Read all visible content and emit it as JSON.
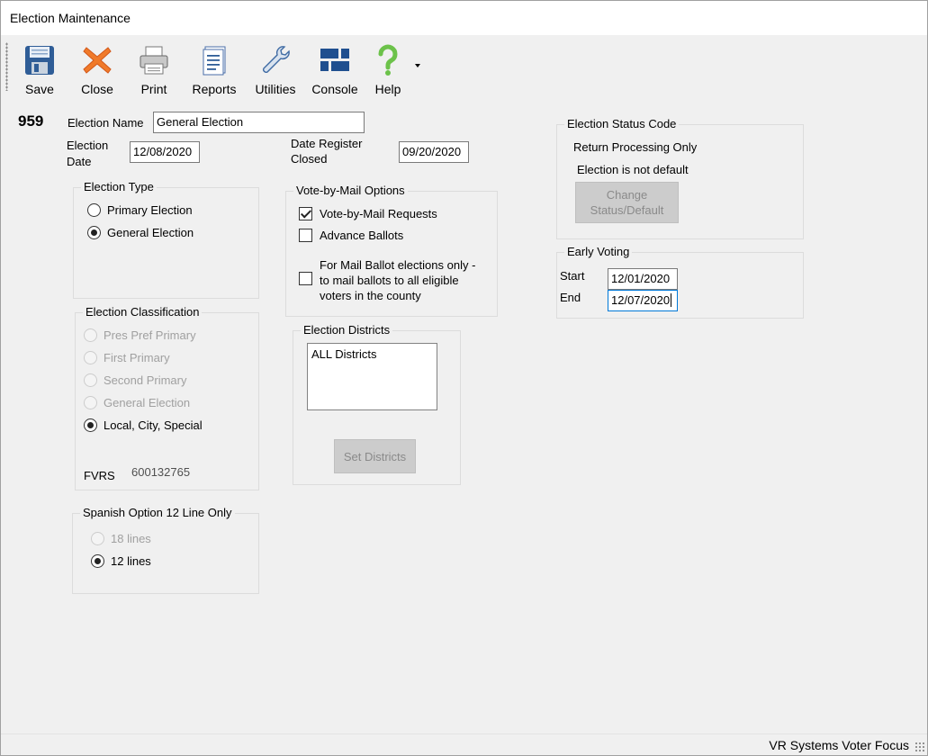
{
  "window": {
    "title": "Election Maintenance"
  },
  "toolbar": {
    "items": [
      {
        "label": "Save",
        "icon": "save-icon"
      },
      {
        "label": "Close",
        "icon": "close-icon"
      },
      {
        "label": "Print",
        "icon": "print-icon"
      },
      {
        "label": "Reports",
        "icon": "reports-icon"
      },
      {
        "label": "Utilities",
        "icon": "utilities-icon"
      },
      {
        "label": "Console",
        "icon": "console-icon"
      },
      {
        "label": "Help",
        "icon": "help-icon"
      }
    ]
  },
  "election": {
    "id": "959",
    "name_label": "Election Name",
    "name_value": "General Election",
    "date_label_1": "Election",
    "date_label_2": "Date",
    "date_value": "12/08/2020",
    "register_label_1": "Date Register",
    "register_label_2": "Closed",
    "register_value": "09/20/2020"
  },
  "election_type": {
    "title": "Election Type",
    "options": [
      {
        "label": "Primary Election",
        "selected": false
      },
      {
        "label": "General Election",
        "selected": true
      }
    ]
  },
  "classification": {
    "title": "Election Classification",
    "options": [
      {
        "label": "Pres Pref Primary",
        "selected": false,
        "enabled": false
      },
      {
        "label": "First Primary",
        "selected": false,
        "enabled": false
      },
      {
        "label": "Second Primary",
        "selected": false,
        "enabled": false
      },
      {
        "label": "General Election",
        "selected": false,
        "enabled": false
      },
      {
        "label": "Local, City, Special",
        "selected": true,
        "enabled": true
      }
    ],
    "fvrs_label": "FVRS",
    "fvrs_value": "600132765"
  },
  "spanish_option": {
    "title": "Spanish Option 12 Line Only",
    "options": [
      {
        "label": "18 lines",
        "selected": false,
        "enabled": false
      },
      {
        "label": "12 lines",
        "selected": true,
        "enabled": true
      }
    ]
  },
  "vbm": {
    "title": "Vote-by-Mail Options",
    "requests_label": "Vote-by-Mail Requests",
    "requests_checked": true,
    "advance_label": "Advance Ballots",
    "advance_checked": false,
    "mail_ballot_line1": "For Mail Ballot elections only -",
    "mail_ballot_line2": "to mail ballots to all eligible",
    "mail_ballot_line3": "voters in the county",
    "mail_ballot_checked": false
  },
  "districts": {
    "title": "Election Districts",
    "items": [
      "ALL Districts"
    ],
    "set_button": "Set Districts"
  },
  "status": {
    "title": "Election Status Code",
    "line1": "Return Processing Only",
    "line2": "Election is not default",
    "change_button_line1": "Change",
    "change_button_line2": "Status/Default"
  },
  "early_voting": {
    "title": "Early Voting",
    "start_label": "Start",
    "start_value": "12/01/2020",
    "end_label": "End",
    "end_value": "12/07/2020"
  },
  "statusbar": {
    "text": "VR Systems Voter Focus"
  }
}
